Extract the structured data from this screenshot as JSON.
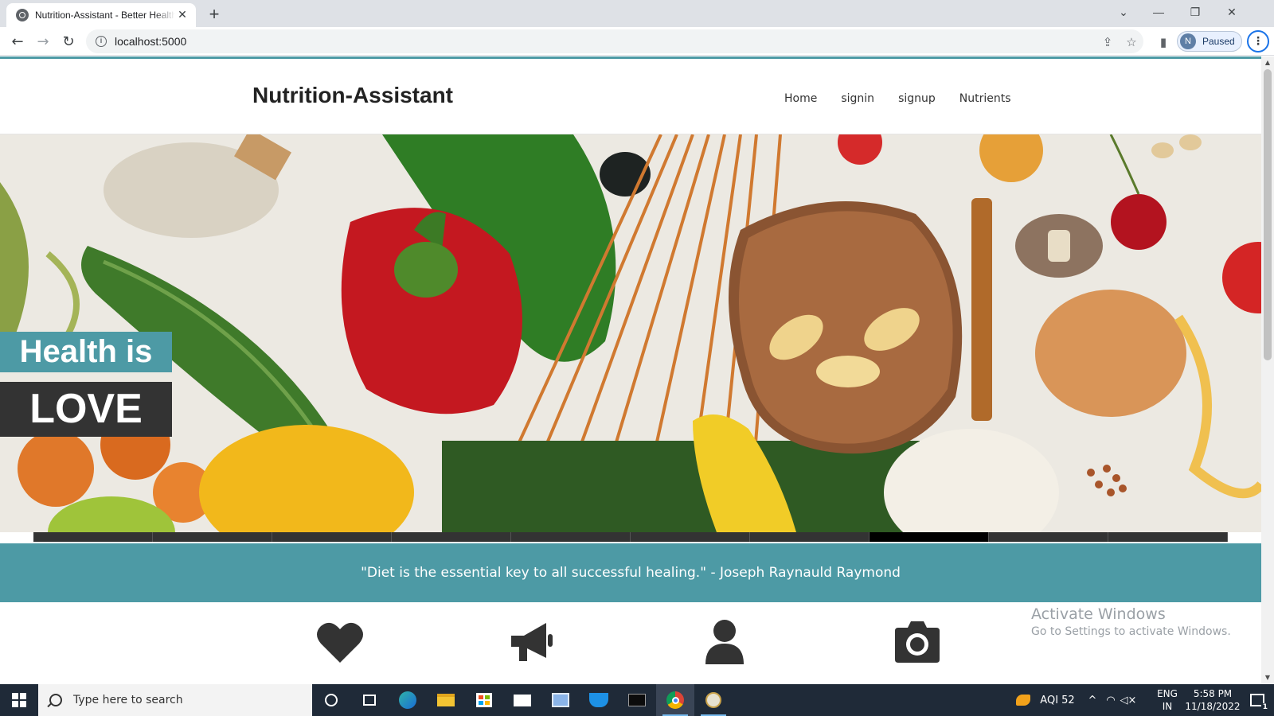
{
  "browser": {
    "tab_title": "Nutrition-Assistant - Better Health",
    "url": "localhost:5000",
    "profile_initial": "N",
    "profile_status": "Paused"
  },
  "site": {
    "brand": "Nutrition-Assistant",
    "nav": [
      "Home",
      "signin",
      "signup",
      "Nutrients"
    ],
    "hero": {
      "line1": "Health is",
      "line2": "LOVE",
      "active_slide": 8,
      "slide_count": 10
    },
    "quote": "\"Diet is the essential key to all successful healing.\" - Joseph Raynauld Raymond",
    "features": [
      "heart-icon",
      "megaphone-icon",
      "user-icon",
      "camera-icon"
    ]
  },
  "watermark": {
    "title": "Activate Windows",
    "subtitle": "Go to Settings to activate Windows."
  },
  "taskbar": {
    "search_placeholder": "Type here to search",
    "weather": "AQI 52",
    "language": "ENG",
    "region": "IN",
    "time": "5:58 PM",
    "date": "11/18/2022",
    "notification_count": "1"
  },
  "colors": {
    "accent": "#4d9aa5",
    "dark_box": "#333333",
    "taskbar": "#1f2a38"
  }
}
